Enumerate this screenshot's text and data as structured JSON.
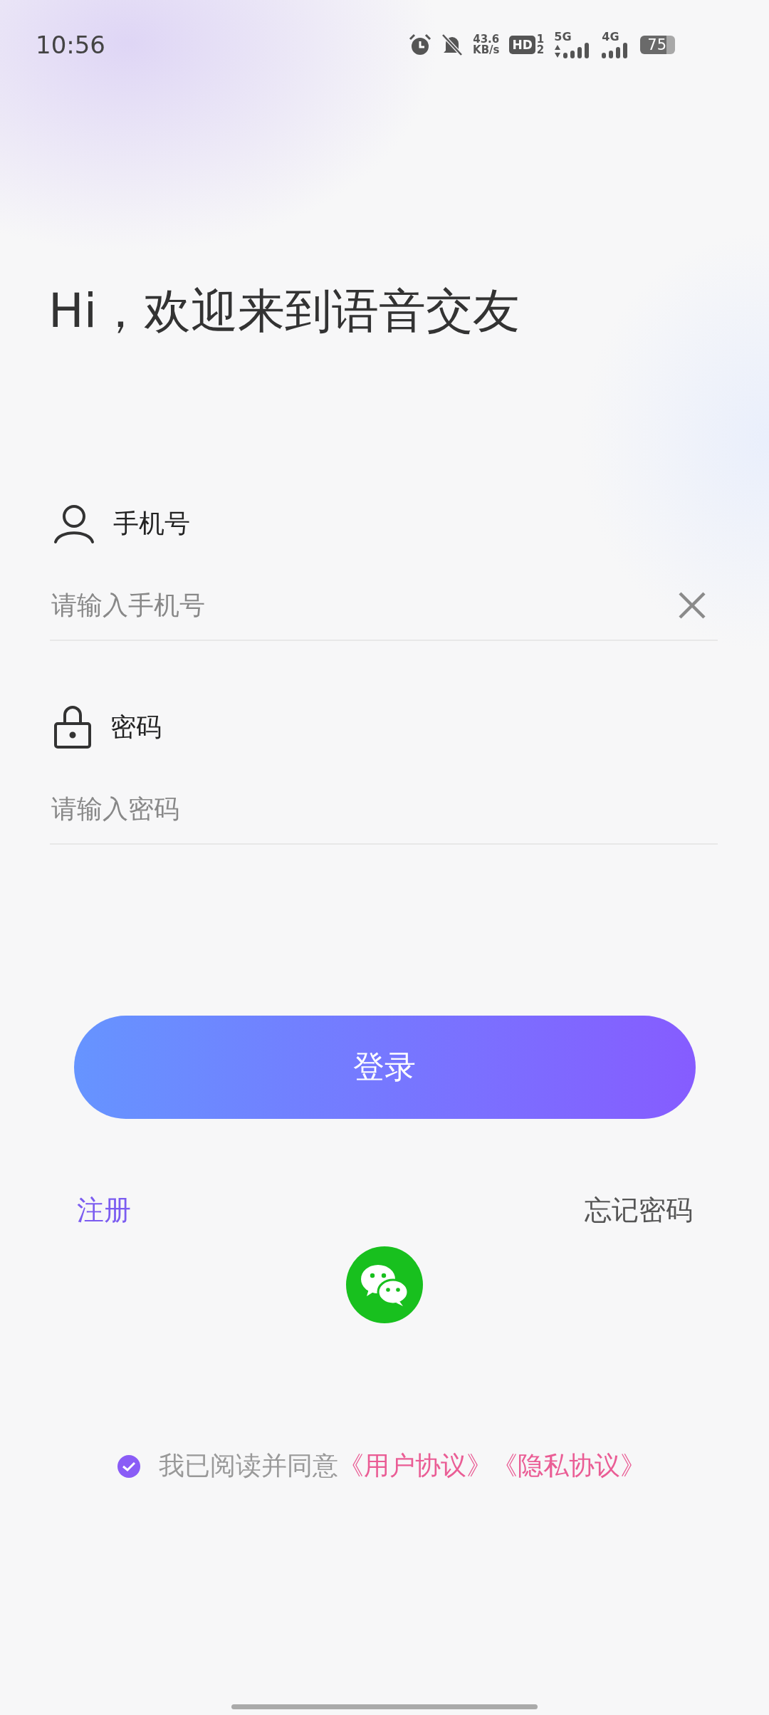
{
  "status_bar": {
    "time": "10:56",
    "network_speed": {
      "value": "43.6",
      "unit": "KB/s"
    },
    "hd_badge": "HD",
    "sim_slots": [
      "1",
      "2"
    ],
    "signals": [
      {
        "kind": "dual",
        "label": "5G"
      },
      {
        "kind": "plain",
        "label": "4G"
      }
    ],
    "battery": "75"
  },
  "title": "Hi，欢迎来到语音交友",
  "fields": [
    {
      "kind": "phone",
      "label": "手机号",
      "placeholder": "请输入手机号",
      "clearable": true
    },
    {
      "kind": "password",
      "label": "密码",
      "placeholder": "请输入密码",
      "clearable": false
    }
  ],
  "login_button": "登录",
  "links": [
    {
      "kind": "register",
      "label": "注册"
    },
    {
      "kind": "forgot",
      "label": "忘记密码"
    }
  ],
  "social_login": [
    {
      "kind": "wechat"
    }
  ],
  "agreement": {
    "checked": true,
    "text": "我已阅读并同意",
    "links": [
      "《用户协议》",
      "《隐私协议》"
    ]
  }
}
